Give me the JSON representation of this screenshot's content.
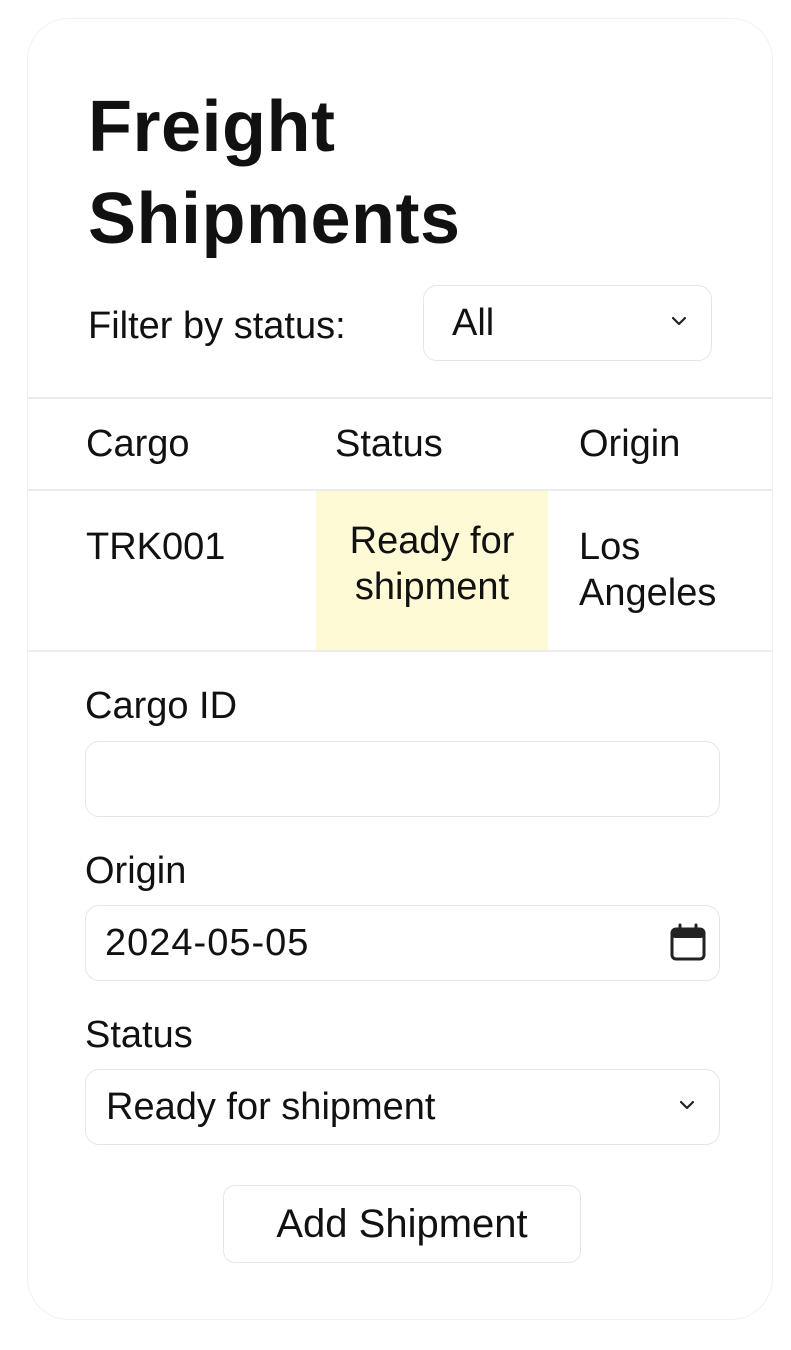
{
  "title_line1": "Freight",
  "title_line2": "Shipments",
  "filter": {
    "label": "Filter by status:",
    "selected": "All"
  },
  "table": {
    "headers": [
      "Cargo",
      "Status",
      "Origin"
    ],
    "rows": [
      {
        "cargo": "TRK001",
        "status_line1": "Ready for",
        "status_line2": "shipment",
        "origin_line1": "Los",
        "origin_line2": "Angeles"
      }
    ],
    "status_highlight_color": "#fdfad5"
  },
  "form": {
    "cargo_id_label": "Cargo ID",
    "cargo_id_value": "",
    "origin_label": "Origin",
    "origin_value": "2024-05-05",
    "status_label": "Status",
    "status_value": "Ready for shipment",
    "submit_label": "Add Shipment"
  },
  "icons": {
    "filter_chevron": "chevron-down-icon",
    "status_chevron": "chevron-down-icon",
    "date_picker": "calendar-icon"
  }
}
